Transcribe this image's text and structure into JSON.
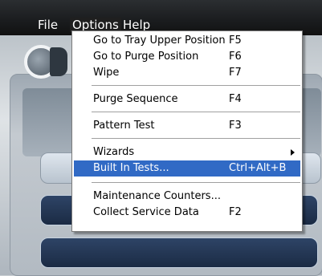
{
  "menubar": {
    "items": [
      "File",
      "Options",
      "Help"
    ]
  },
  "options_menu": {
    "groups": [
      [
        {
          "label": "Go to Tray Upper Position",
          "shortcut": "F5"
        },
        {
          "label": "Go to Purge Position",
          "shortcut": "F6"
        },
        {
          "label": "Wipe",
          "shortcut": "F7"
        }
      ],
      [
        {
          "label": "Purge Sequence",
          "shortcut": "F4"
        }
      ],
      [
        {
          "label": "Pattern Test",
          "shortcut": "F3"
        }
      ],
      [
        {
          "label": "Wizards",
          "shortcut": "",
          "submenu": true
        },
        {
          "label": "Built In Tests...",
          "shortcut": "Ctrl+Alt+B",
          "selected": true
        }
      ],
      [
        {
          "label": "Maintenance Counters...",
          "shortcut": ""
        },
        {
          "label": "Collect Service Data",
          "shortcut": "F2"
        }
      ]
    ]
  },
  "colors": {
    "menubar_bg": "#1a1c1e",
    "highlight": "#316ac5",
    "menu_bg": "#ffffff"
  }
}
